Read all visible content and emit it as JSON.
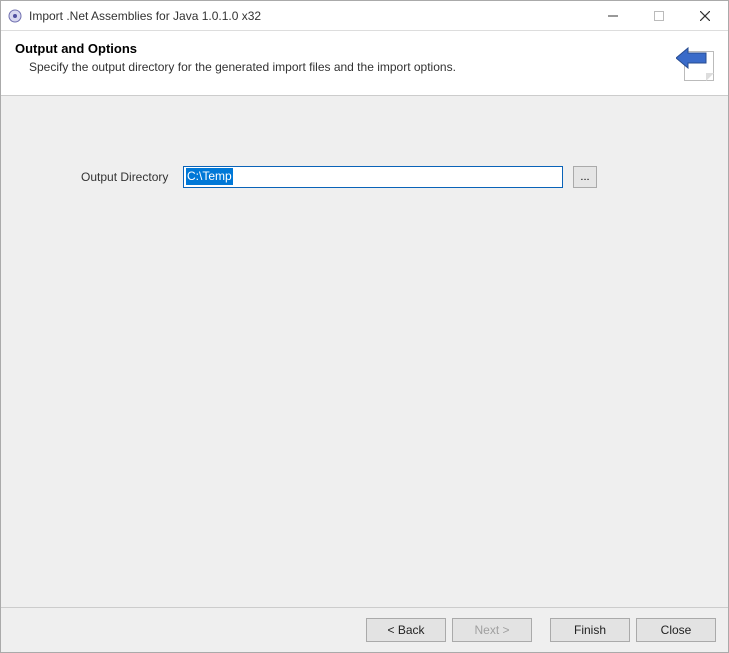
{
  "window": {
    "title": "Import .Net Assemblies for Java 1.0.1.0 x32"
  },
  "header": {
    "title": "Output and Options",
    "subtitle": "Specify the output directory for the generated import files and the import options."
  },
  "form": {
    "output_directory_label": "Output Directory",
    "output_directory_value": "C:\\Temp",
    "browse_label": "..."
  },
  "buttons": {
    "back": "< Back",
    "next": "Next >",
    "finish": "Finish",
    "close": "Close"
  }
}
